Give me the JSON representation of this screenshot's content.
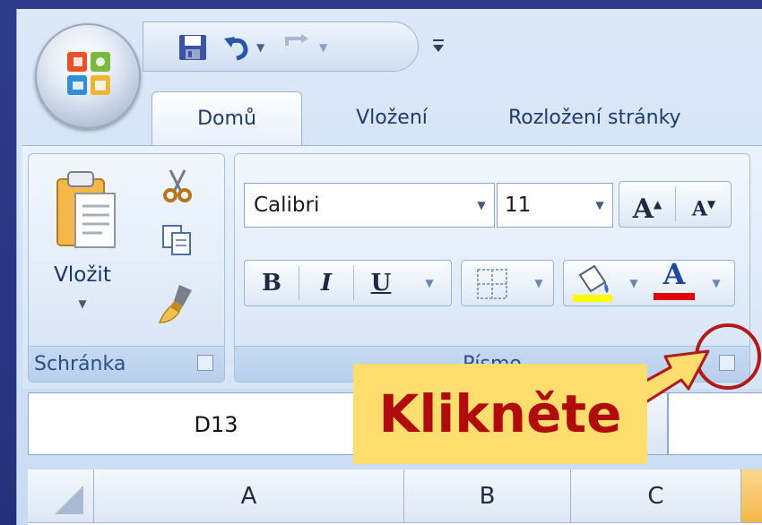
{
  "qat": {
    "save_icon": "save-icon",
    "undo_icon": "undo-icon",
    "redo_icon": "redo-icon",
    "customize_icon": "customize-qat-icon"
  },
  "tabs": [
    {
      "label": "Domů",
      "active": true
    },
    {
      "label": "Vložení",
      "active": false
    },
    {
      "label": "Rozložení stránky",
      "active": false
    }
  ],
  "clipboard_group": {
    "paste_label": "Vložit",
    "group_label": "Schránka"
  },
  "font_group": {
    "font_name": "Calibri",
    "font_size": "11",
    "grow_label": "A",
    "shrink_label": "A",
    "bold_label": "B",
    "italic_label": "I",
    "underline_label": "U",
    "font_color_label": "A",
    "group_label": "Písmo",
    "fill_color": "#ffff00",
    "font_color": "#e00000"
  },
  "name_box": {
    "value": "D13"
  },
  "columns": [
    "A",
    "B",
    "C"
  ],
  "callout": {
    "text": "Klikněte"
  },
  "colors": {
    "callout_bg": "#ffdd6e",
    "callout_text": "#b00c0c",
    "highlight_circle": "#b01a1a"
  }
}
